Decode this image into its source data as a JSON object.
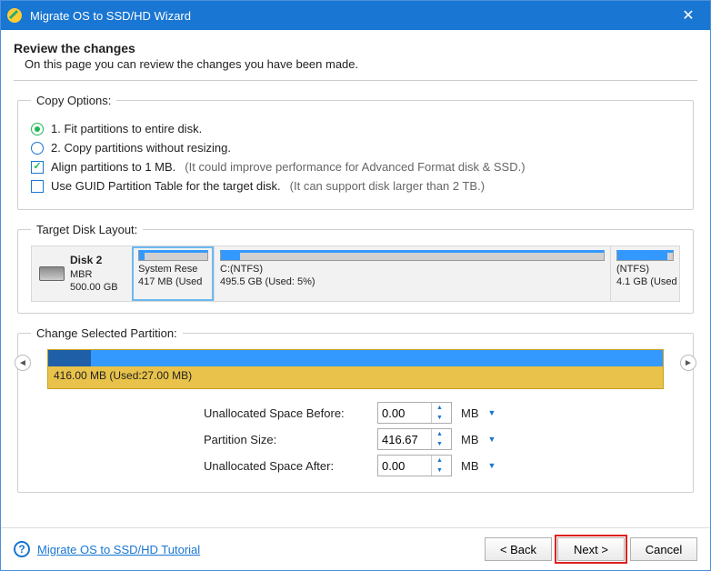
{
  "titlebar": {
    "title": "Migrate OS to SSD/HD Wizard"
  },
  "header": {
    "heading": "Review the changes",
    "sub": "On this page you can review the changes you have been made."
  },
  "copy_options": {
    "legend": "Copy Options:",
    "opt1": "1. Fit partitions to entire disk.",
    "opt2": "2. Copy partitions without resizing.",
    "align": "Align partitions to 1 MB.",
    "align_hint": "(It could improve performance for Advanced Format disk & SSD.)",
    "gpt": "Use GUID Partition Table for the target disk.",
    "gpt_hint": "(It can support disk larger than 2 TB.)"
  },
  "target_disk": {
    "legend": "Target Disk Layout:",
    "disk_name": "Disk 2",
    "disk_scheme": "MBR",
    "disk_size": "500.00 GB",
    "parts": [
      {
        "label1": "System Rese",
        "label2": "417 MB (Used"
      },
      {
        "label1": "C:(NTFS)",
        "label2": "495.5 GB (Used: 5%)"
      },
      {
        "label1": "(NTFS)",
        "label2": "4.1 GB (Used"
      }
    ]
  },
  "change": {
    "legend": "Change Selected Partition:",
    "summary": "416.00 MB (Used:27.00 MB)",
    "rows": {
      "before_label": "Unallocated Space Before:",
      "before_val": "0.00",
      "size_label": "Partition Size:",
      "size_val": "416.67",
      "after_label": "Unallocated Space After:",
      "after_val": "0.00",
      "unit": "MB"
    }
  },
  "footer": {
    "tutorial": "Migrate OS to SSD/HD Tutorial",
    "back": "< Back",
    "next": "Next >",
    "cancel": "Cancel"
  }
}
